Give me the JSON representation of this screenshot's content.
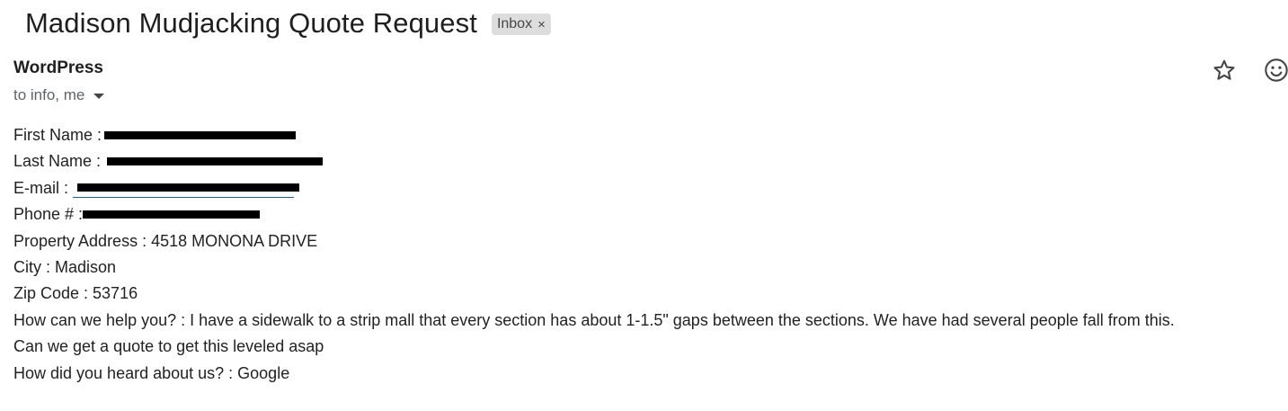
{
  "email": {
    "subject": "Madison Mudjacking Quote Request",
    "label": "Inbox",
    "label_remove_glyph": "×",
    "sender": "WordPress",
    "recipients": "to info, me"
  },
  "icons": {
    "star": "star-icon",
    "emoji": "emoji-icon",
    "dropdown": "chevron-down-icon"
  },
  "fields": {
    "first_name_label": "First Name :",
    "last_name_label": "Last Name :",
    "email_label": "E-mail :",
    "phone_label": "Phone # :",
    "property_address": "Property Address : 4518 MONONA DRIVE",
    "city": "City : Madison",
    "zip": "Zip Code : 53716",
    "help_line1": "How can we help you? : I have a sidewalk to a strip mall that every section has about 1-1.5\" gaps between the sections. We have had several people fall from this.",
    "help_line2": "Can we get a quote to get this leveled asap",
    "heard": "How did you heard about us? : Google"
  },
  "colors": {
    "link": "#1a56c7",
    "chip_bg": "#dddddd"
  }
}
